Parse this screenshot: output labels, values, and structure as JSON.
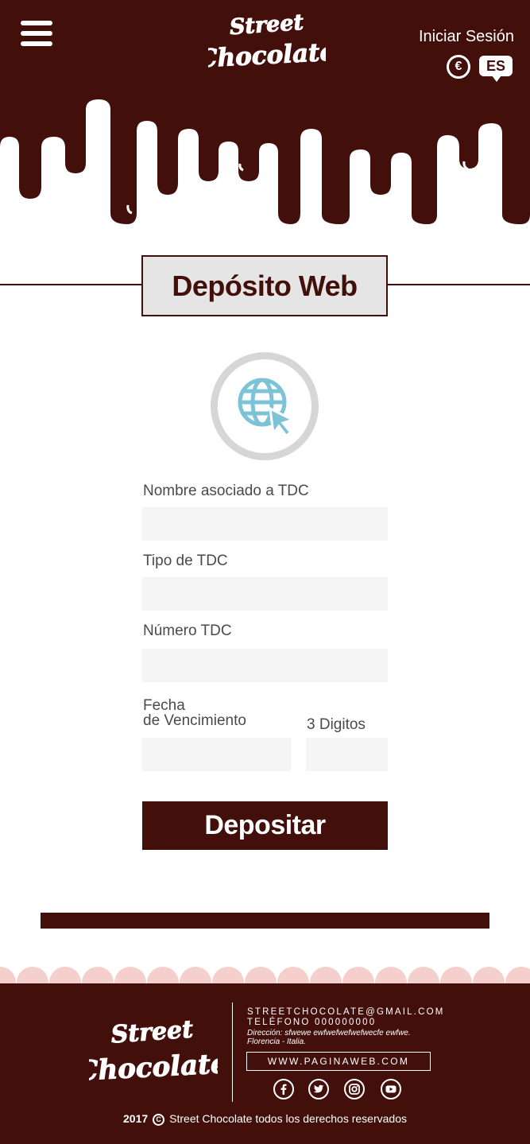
{
  "header": {
    "logo_line1": "Street",
    "logo_line2": "Chocolate",
    "login_label": "Iniciar Sesión",
    "currency_symbol": "€",
    "language_label": "ES"
  },
  "main": {
    "title": "Depósito Web",
    "form": {
      "name_label": "Nombre asociado a TDC",
      "name_value": "",
      "card_type_label": "Tipo de TDC",
      "card_type_value": "",
      "card_number_label": "Número TDC",
      "card_number_value": "",
      "expiry_label_line1": "Fecha",
      "expiry_label_line2": "de Vencimiento",
      "expiry_value": "",
      "cvv_label": "3 Digitos",
      "cvv_value": "",
      "submit_label": "Depositar"
    }
  },
  "footer": {
    "logo_line1": "Street",
    "logo_line2": "Chocolate",
    "email": "STREETCHOCOLATE@GMAIL.COM",
    "phone": "TELÉFONO 000000000",
    "address": "Dirección: sfwewe ewfwefwefwefwecfe ewfwe. Florencia - Italia.",
    "website": "WWW.PAGINAWEB.COM",
    "social": [
      "facebook-icon",
      "twitter-icon",
      "instagram-icon",
      "youtube-icon"
    ],
    "year": "2017",
    "copyright_text": "Street Chocolate todos los derechos reservados"
  },
  "colors": {
    "chocolate": "#420f0b",
    "panel": "#e5e5e6",
    "accent_globe": "#7cc3d8",
    "scallop": "#f5cfcc"
  }
}
